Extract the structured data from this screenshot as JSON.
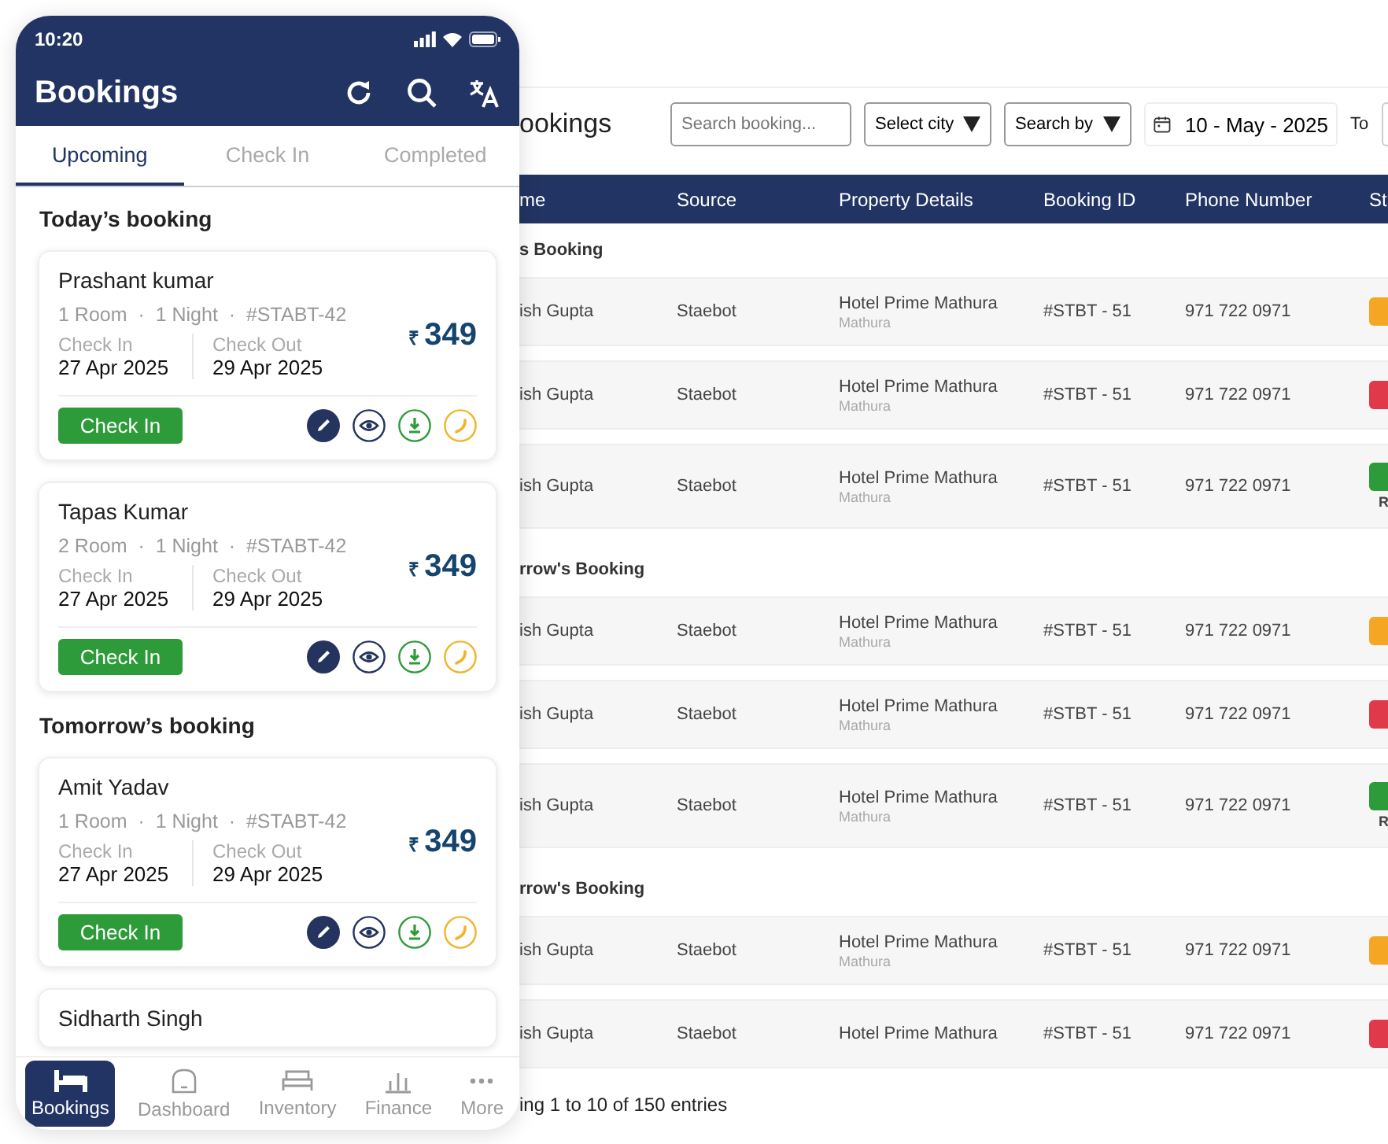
{
  "phone": {
    "status_bar": {
      "time": "10:20"
    },
    "header": {
      "title": "Bookings"
    },
    "tabs": [
      {
        "label": "Upcoming",
        "selected": true
      },
      {
        "label": "Check In",
        "selected": false
      },
      {
        "label": "Completed",
        "selected": false
      }
    ],
    "sections": [
      {
        "title": "Today’s booking",
        "bookings": [
          {
            "guest": "Prashant kumar",
            "meta": "1 Room  ·  1 Night  ·  #STABT-42",
            "currency": "₹",
            "amount": "349",
            "check_in_label": "Check In",
            "check_in": "27 Apr 2025",
            "check_out_label": "Check Out",
            "check_out": "29 Apr 2025",
            "button": "Check In"
          },
          {
            "guest": "Tapas Kumar",
            "meta": "2 Room  ·  1 Night  ·  #STABT-42",
            "currency": "₹",
            "amount": "349",
            "check_in_label": "Check In",
            "check_in": "27 Apr 2025",
            "check_out_label": "Check Out",
            "check_out": "29 Apr 2025",
            "button": "Check In"
          }
        ]
      },
      {
        "title": "Tomorrow’s booking",
        "bookings": [
          {
            "guest": "Amit Yadav",
            "meta": "1 Room  ·  1 Night  ·  #STABT-42",
            "currency": "₹",
            "amount": "349",
            "check_in_label": "Check In",
            "check_in": "27 Apr 2025",
            "check_out_label": "Check Out",
            "check_out": "29 Apr 2025",
            "button": "Check In"
          },
          {
            "guest": "Sidharth Singh"
          }
        ]
      }
    ],
    "nav": [
      {
        "kind": "bookings",
        "label": "Bookings",
        "selected": true
      },
      {
        "kind": "dashboard",
        "label": "Dashboard",
        "selected": false
      },
      {
        "kind": "inventory",
        "label": "Inventory",
        "selected": false
      },
      {
        "kind": "finance",
        "label": "Finance",
        "selected": false
      },
      {
        "kind": "more",
        "label": "More",
        "selected": false
      }
    ]
  },
  "desktop": {
    "title": "ookings",
    "filters": {
      "search_placeholder": "Search booking...",
      "city": "Select city",
      "search_by": "Search by",
      "date_from": "10 - May - 2025",
      "to_label": "To"
    },
    "table": {
      "columns": [
        "me",
        "Source",
        "Property Details",
        "Booking ID",
        "Phone Number",
        "St"
      ],
      "groups": [
        {
          "title": "s Booking",
          "rows": [
            {
              "name": "ish Gupta",
              "source": "Staebot",
              "property": "Hotel Prime Mathura",
              "city": "Mathura",
              "booking_id": "#STBT - 51",
              "phone": "971 722 0971",
              "color": "#f5a623"
            },
            {
              "name": "ish Gupta",
              "source": "Staebot",
              "property": "Hotel Prime Mathura",
              "city": "Mathura",
              "booking_id": "#STBT - 51",
              "phone": "971 722 0971",
              "color": "#e0394a"
            },
            {
              "name": "ish Gupta",
              "source": "Staebot",
              "property": "Hotel Prime Mathura",
              "city": "Mathura",
              "booking_id": "#STBT - 51",
              "phone": "971 722 0971",
              "color": "#2e9b3a",
              "status_note": "R"
            }
          ]
        },
        {
          "title": "rrow's Booking",
          "rows": [
            {
              "name": "ish Gupta",
              "source": "Staebot",
              "property": "Hotel Prime Mathura",
              "city": "Mathura",
              "booking_id": "#STBT - 51",
              "phone": "971 722 0971",
              "color": "#f5a623"
            },
            {
              "name": "ish Gupta",
              "source": "Staebot",
              "property": "Hotel Prime Mathura",
              "city": "Mathura",
              "booking_id": "#STBT - 51",
              "phone": "971 722 0971",
              "color": "#e0394a"
            },
            {
              "name": "ish Gupta",
              "source": "Staebot",
              "property": "Hotel Prime Mathura",
              "city": "Mathura",
              "booking_id": "#STBT - 51",
              "phone": "971 722 0971",
              "color": "#2e9b3a",
              "status_note": "R"
            }
          ]
        },
        {
          "title": "rrow's Booking",
          "rows": [
            {
              "name": "ish Gupta",
              "source": "Staebot",
              "property": "Hotel Prime Mathura",
              "city": "Mathura",
              "booking_id": "#STBT - 51",
              "phone": "971 722 0971",
              "color": "#f5a623"
            },
            {
              "name": "ish Gupta",
              "source": "Staebot",
              "property": "Hotel Prime Mathura",
              "booking_id": "#STBT - 51",
              "phone": "971 722 0971",
              "color": "#e0394a"
            }
          ]
        }
      ]
    },
    "footer": "ing 1 to 10 of 150 entries"
  }
}
